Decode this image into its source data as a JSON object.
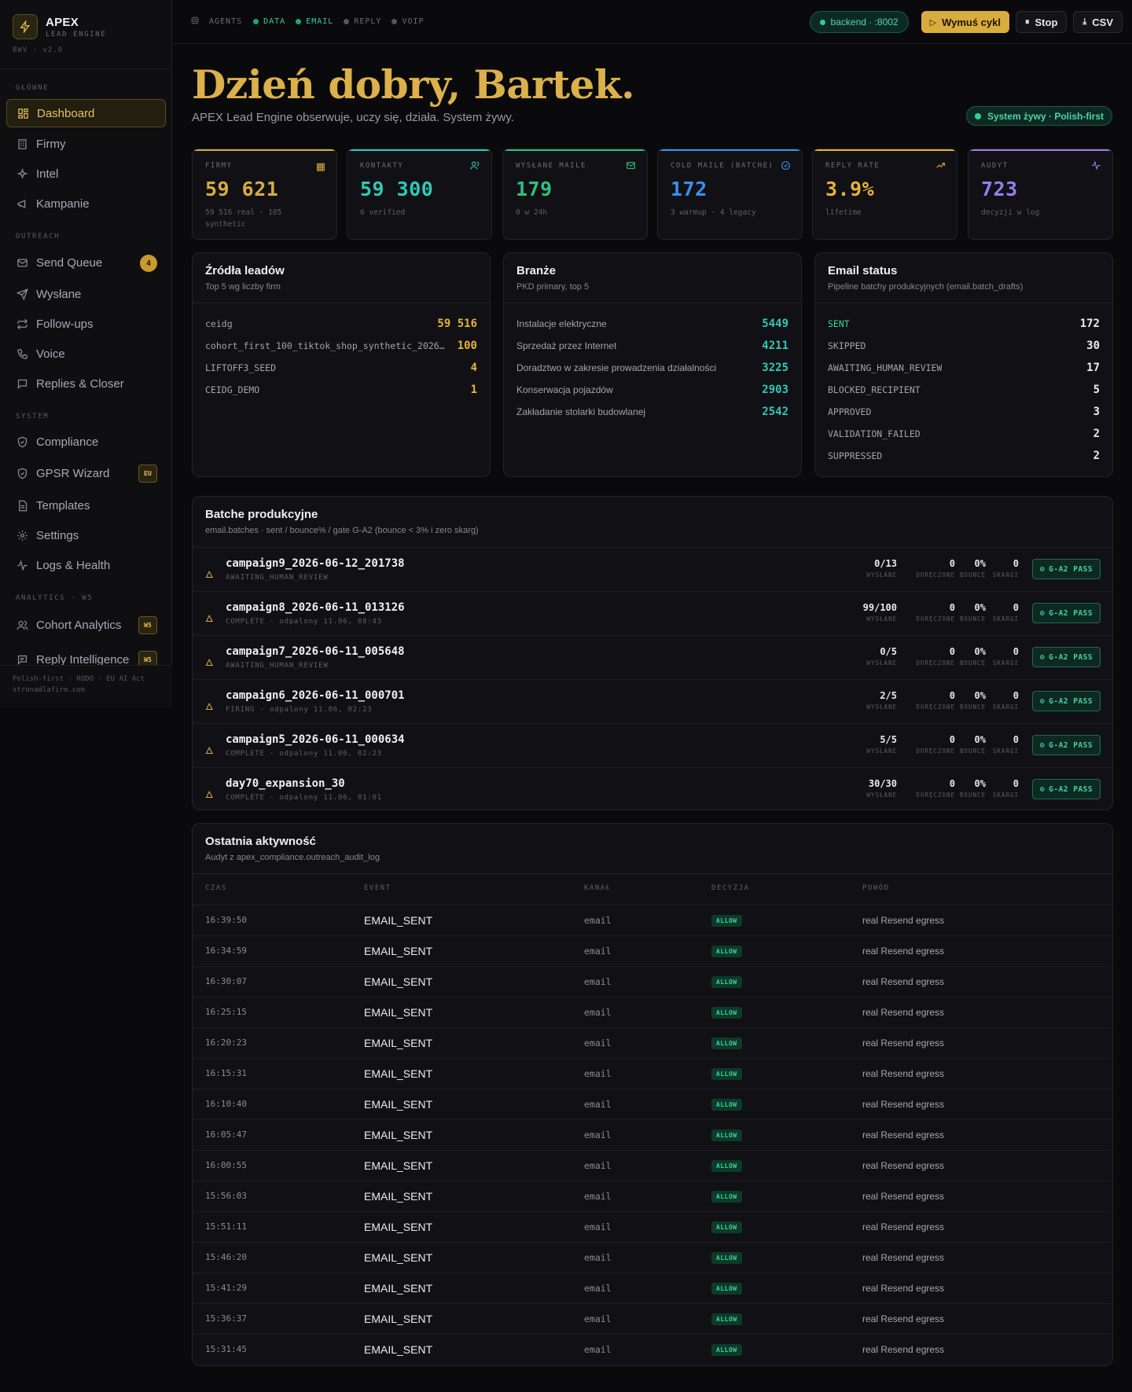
{
  "brand": {
    "name": "APEX",
    "sub": "LEAD ENGINE",
    "version": "BWV · v2.0"
  },
  "sidebar": {
    "groups": [
      "GŁÓWNE",
      "OUTREACH",
      "SYSTEM",
      "ANALYTICS · W5"
    ],
    "items": [
      {
        "label": "Dashboard",
        "icon": "grid-icon"
      },
      {
        "label": "Firmy",
        "icon": "building-icon"
      },
      {
        "label": "Intel",
        "icon": "sparkle-icon"
      },
      {
        "label": "Kampanie",
        "icon": "megaphone-icon"
      },
      {
        "label": "Send Queue",
        "icon": "mail-icon",
        "badge": "4"
      },
      {
        "label": "Wysłane",
        "icon": "send-icon"
      },
      {
        "label": "Follow-ups",
        "icon": "repeat-icon"
      },
      {
        "label": "Voice",
        "icon": "phone-icon"
      },
      {
        "label": "Replies & Closer",
        "icon": "chat-icon"
      },
      {
        "label": "Compliance",
        "icon": "shield-icon"
      },
      {
        "label": "GPSR Wizard",
        "icon": "shield-icon",
        "tag": "EU"
      },
      {
        "label": "Templates",
        "icon": "file-icon"
      },
      {
        "label": "Settings",
        "icon": "gear-icon"
      },
      {
        "label": "Logs & Health",
        "icon": "pulse-icon"
      },
      {
        "label": "Cohort Analytics",
        "icon": "users-icon",
        "tag": "W5"
      },
      {
        "label": "Reply Intelligence",
        "icon": "chat-icon",
        "tag": "W5"
      }
    ],
    "footer": [
      "Polish-first · RODO · EU AI Act",
      "stronadlafirm.com"
    ]
  },
  "topbar": {
    "agents": [
      {
        "label": "AGENTS",
        "state": "label"
      },
      {
        "label": "DATA",
        "state": "on"
      },
      {
        "label": "EMAIL",
        "state": "on"
      },
      {
        "label": "REPLY",
        "state": "off"
      },
      {
        "label": "VOIP",
        "state": "off"
      }
    ],
    "backend": "backend · :8002",
    "force_cycle": "Wymuś cykl",
    "stop": "Stop",
    "csv": "CSV"
  },
  "hero": {
    "title": "Dzień dobry, Bartek.",
    "subtitle": "APEX Lead Engine obserwuje, uczy się, działa. System żywy.",
    "live": "System żywy · Polish-first"
  },
  "kpis": [
    {
      "label": "FIRMY",
      "value": "59 621",
      "sub": "59 516 real · 105 synthetic",
      "color": "#d9ac3f",
      "icon": "building-icon"
    },
    {
      "label": "KONTAKTY",
      "value": "59 300",
      "sub": "6 verified",
      "color": "#2fc9b8",
      "icon": "users-icon"
    },
    {
      "label": "WYSŁANE MAILE",
      "value": "179",
      "sub": "0 w 24h",
      "color": "#2fbf7f",
      "icon": "mail-icon"
    },
    {
      "label": "COLD MAILE (BATCHE)",
      "value": "172",
      "sub": "3 warmup · 4 legacy",
      "color": "#3d8ff0",
      "icon": "check-circle-icon"
    },
    {
      "label": "REPLY RATE",
      "value": "3.9%",
      "sub": "lifetime",
      "color": "#e6b23c",
      "icon": "trend-up-icon"
    },
    {
      "label": "AUDYT",
      "value": "723",
      "sub": "decyzji w log",
      "color": "#9a7cf0",
      "icon": "pulse-icon"
    }
  ],
  "sources": {
    "title": "Źródła leadów",
    "subtitle": "Top 5 wg liczby firm",
    "rows": [
      {
        "k": "ceidg",
        "v": "59 516"
      },
      {
        "k": "cohort_first_100_tiktok_shop_synthetic_2026…",
        "v": "100"
      },
      {
        "k": "LIFTOFF3_SEED",
        "v": "4"
      },
      {
        "k": "CEIDG_DEMO",
        "v": "1"
      }
    ]
  },
  "industries": {
    "title": "Branże",
    "subtitle": "PKD primary, top 5",
    "rows": [
      {
        "k": "Instalacje elektryczne",
        "v": "5449"
      },
      {
        "k": "Sprzedaż przez Internet",
        "v": "4211"
      },
      {
        "k": "Doradztwo w zakresie prowadzenia działalności",
        "v": "3225"
      },
      {
        "k": "Konserwacja pojazdów",
        "v": "2903"
      },
      {
        "k": "Zakładanie stolarki budowlanej",
        "v": "2542"
      }
    ]
  },
  "email_status": {
    "title": "Email status",
    "subtitle": "Pipeline batchy produkcyjnych (email.batch_drafts)",
    "rows": [
      {
        "k": "SENT",
        "v": "172"
      },
      {
        "k": "SKIPPED",
        "v": "30"
      },
      {
        "k": "AWAITING_HUMAN_REVIEW",
        "v": "17"
      },
      {
        "k": "BLOCKED_RECIPIENT",
        "v": "5"
      },
      {
        "k": "APPROVED",
        "v": "3"
      },
      {
        "k": "VALIDATION_FAILED",
        "v": "2"
      },
      {
        "k": "SUPPRESSED",
        "v": "2"
      }
    ]
  },
  "batches": {
    "title": "Batche produkcyjne",
    "subtitle": "email.batches · sent / bounce% / gate G-A2 (bounce < 3% i zero skarg)",
    "stat_labels": [
      "WYSŁANE",
      "DORĘCZONE",
      "BOUNCE",
      "SKARGI"
    ],
    "gate_label": "G-A2 PASS",
    "rows": [
      {
        "name": "campaign9_2026-06-12_201738",
        "status": "AWAITING_HUMAN_REVIEW",
        "sent": "0/13",
        "delivered": "0",
        "bounce": "0%",
        "complaints": "0"
      },
      {
        "name": "campaign8_2026-06-11_013126",
        "status": "COMPLETE · odpalony 11.06, 08:43",
        "sent": "99/100",
        "delivered": "0",
        "bounce": "0%",
        "complaints": "0"
      },
      {
        "name": "campaign7_2026-06-11_005648",
        "status": "AWAITING_HUMAN_REVIEW",
        "sent": "0/5",
        "delivered": "0",
        "bounce": "0%",
        "complaints": "0"
      },
      {
        "name": "campaign6_2026-06-11_000701",
        "status": "FIRING · odpalony 11.06, 02:23",
        "sent": "2/5",
        "delivered": "0",
        "bounce": "0%",
        "complaints": "0"
      },
      {
        "name": "campaign5_2026-06-11_000634",
        "status": "COMPLETE · odpalony 11.06, 02:23",
        "sent": "5/5",
        "delivered": "0",
        "bounce": "0%",
        "complaints": "0"
      },
      {
        "name": "day70_expansion_30",
        "status": "COMPLETE · odpalony 11.06, 01:01",
        "sent": "30/30",
        "delivered": "0",
        "bounce": "0%",
        "complaints": "0"
      }
    ]
  },
  "activity": {
    "title": "Ostatnia aktywność",
    "subtitle": "Audyt z apex_compliance.outreach_audit_log",
    "columns": [
      "CZAS",
      "EVENT",
      "KANAŁ",
      "DECYZJA",
      "POWÓD"
    ],
    "rows": [
      {
        "time": "16:39:50",
        "event": "EMAIL_SENT",
        "channel": "email",
        "decision": "ALLOW",
        "reason": "real Resend egress"
      },
      {
        "time": "16:34:59",
        "event": "EMAIL_SENT",
        "channel": "email",
        "decision": "ALLOW",
        "reason": "real Resend egress"
      },
      {
        "time": "16:30:07",
        "event": "EMAIL_SENT",
        "channel": "email",
        "decision": "ALLOW",
        "reason": "real Resend egress"
      },
      {
        "time": "16:25:15",
        "event": "EMAIL_SENT",
        "channel": "email",
        "decision": "ALLOW",
        "reason": "real Resend egress"
      },
      {
        "time": "16:20:23",
        "event": "EMAIL_SENT",
        "channel": "email",
        "decision": "ALLOW",
        "reason": "real Resend egress"
      },
      {
        "time": "16:15:31",
        "event": "EMAIL_SENT",
        "channel": "email",
        "decision": "ALLOW",
        "reason": "real Resend egress"
      },
      {
        "time": "16:10:40",
        "event": "EMAIL_SENT",
        "channel": "email",
        "decision": "ALLOW",
        "reason": "real Resend egress"
      },
      {
        "time": "16:05:47",
        "event": "EMAIL_SENT",
        "channel": "email",
        "decision": "ALLOW",
        "reason": "real Resend egress"
      },
      {
        "time": "16:00:55",
        "event": "EMAIL_SENT",
        "channel": "email",
        "decision": "ALLOW",
        "reason": "real Resend egress"
      },
      {
        "time": "15:56:03",
        "event": "EMAIL_SENT",
        "channel": "email",
        "decision": "ALLOW",
        "reason": "real Resend egress"
      },
      {
        "time": "15:51:11",
        "event": "EMAIL_SENT",
        "channel": "email",
        "decision": "ALLOW",
        "reason": "real Resend egress"
      },
      {
        "time": "15:46:20",
        "event": "EMAIL_SENT",
        "channel": "email",
        "decision": "ALLOW",
        "reason": "real Resend egress"
      },
      {
        "time": "15:41:29",
        "event": "EMAIL_SENT",
        "channel": "email",
        "decision": "ALLOW",
        "reason": "real Resend egress"
      },
      {
        "time": "15:36:37",
        "event": "EMAIL_SENT",
        "channel": "email",
        "decision": "ALLOW",
        "reason": "real Resend egress"
      },
      {
        "time": "15:31:45",
        "event": "EMAIL_SENT",
        "channel": "email",
        "decision": "ALLOW",
        "reason": "real Resend egress"
      }
    ]
  },
  "colors": {
    "gold": "#d9ac3f",
    "teal": "#2fc9b8",
    "green": "#2fbf7f",
    "status_sent": "#3fd39b"
  }
}
